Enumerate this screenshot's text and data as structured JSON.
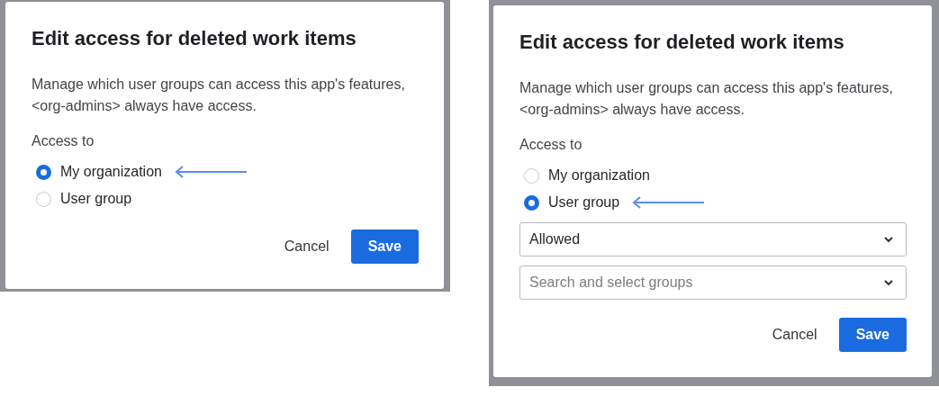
{
  "panels": [
    {
      "title": "Edit access for deleted work items",
      "description": "Manage which user groups can access this app's features, <org-admins> always have access.",
      "access_label": "Access to",
      "options": [
        {
          "label": "My organization",
          "selected": true,
          "annotated": true
        },
        {
          "label": "User group",
          "selected": false,
          "annotated": false
        }
      ],
      "buttons": [
        {
          "label": "Cancel",
          "kind": "secondary"
        },
        {
          "label": "Save",
          "kind": "primary"
        }
      ]
    },
    {
      "title": "Edit access for deleted work items",
      "description": "Manage which user groups can access this app's features, <org-admins> always have access.",
      "access_label": "Access to",
      "options": [
        {
          "label": "My organization",
          "selected": false,
          "annotated": false
        },
        {
          "label": "User group",
          "selected": true,
          "annotated": true
        }
      ],
      "dropdowns": [
        {
          "value": "Allowed"
        },
        {
          "placeholder": "Search and select groups"
        }
      ],
      "buttons": [
        {
          "label": "Cancel",
          "kind": "secondary"
        },
        {
          "label": "Save",
          "kind": "primary"
        }
      ]
    }
  ]
}
